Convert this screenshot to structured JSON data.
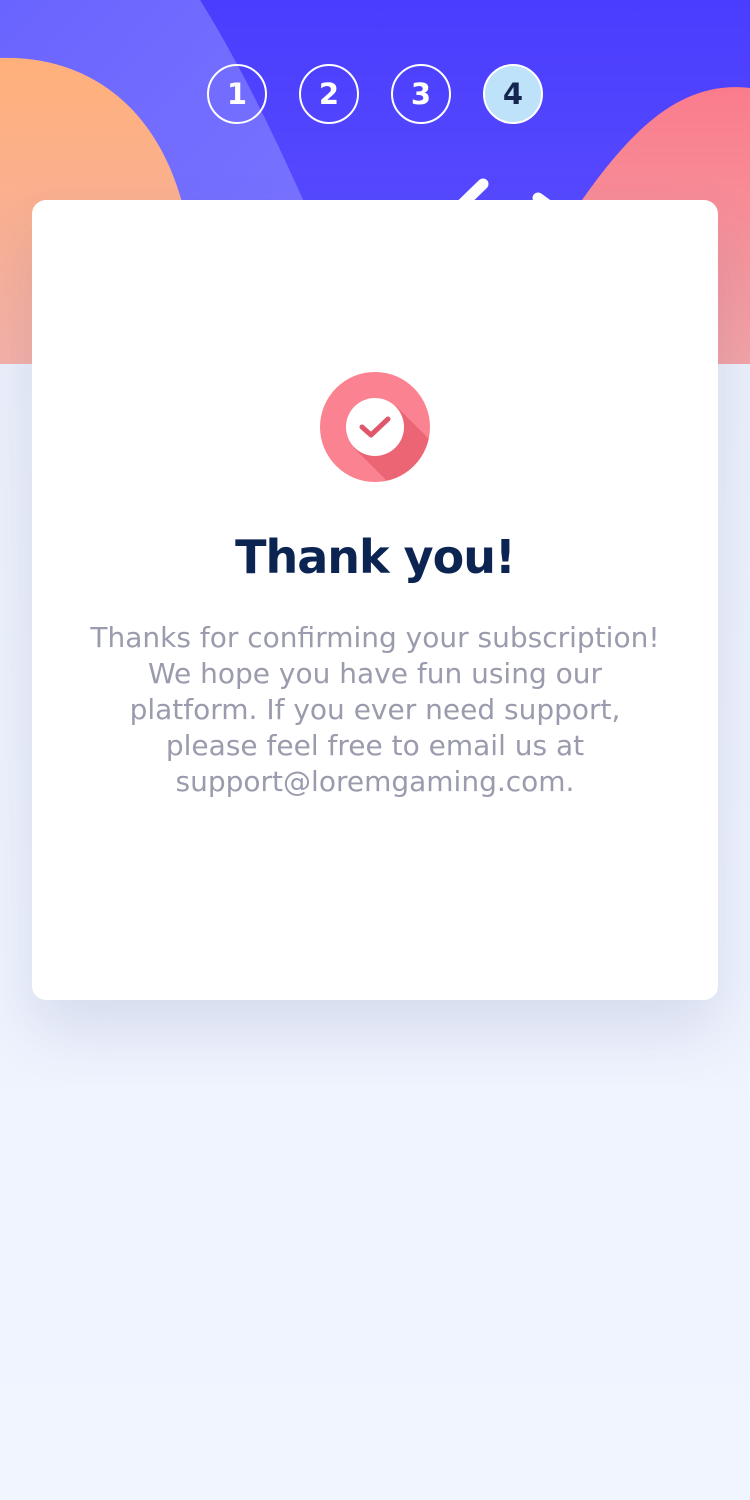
{
  "stepper": {
    "steps": [
      {
        "label": "1",
        "state": "inactive"
      },
      {
        "label": "2",
        "state": "inactive"
      },
      {
        "label": "3",
        "state": "inactive"
      },
      {
        "label": "4",
        "state": "active"
      }
    ],
    "current_step": 4
  },
  "confirmation": {
    "icon": "check-circle-icon",
    "title": "Thank you!",
    "message": "Thanks for confirming your subscription! We hope you have fun using our platform. If you ever need support, please feel free to email us at support@loremgaming.com."
  },
  "colors": {
    "hero_blue": "#4a3dfe",
    "blob_orange": "#ffb07a",
    "blob_pink": "#fa8090",
    "icon_pink": "#fb8391",
    "active_step": "#bfe2fb",
    "title_navy": "#0c2452",
    "body_text": "#9a9cad",
    "page_background": "#eef3fd"
  }
}
